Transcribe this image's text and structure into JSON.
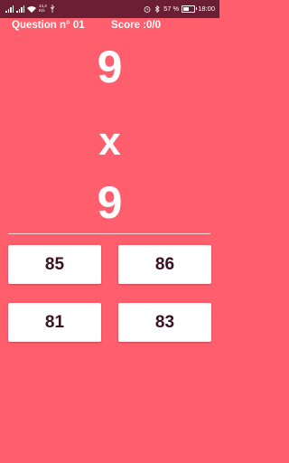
{
  "status_bar": {
    "net_speed_value": "14,4",
    "net_speed_unit": "K/s",
    "battery_percent": "57 %",
    "battery_level": 0.57,
    "time": "18:00"
  },
  "header": {
    "question_label": "Question n° 01",
    "score_label": "Score :0/0"
  },
  "problem": {
    "operand1": "9",
    "operator": "x",
    "operand2": "9"
  },
  "answers": [
    {
      "label": "85"
    },
    {
      "label": "86"
    },
    {
      "label": "81"
    },
    {
      "label": "83"
    }
  ],
  "colors": {
    "background": "#FF5F6D",
    "status_bar": "#6B1F34",
    "button_text": "#3A1121"
  }
}
